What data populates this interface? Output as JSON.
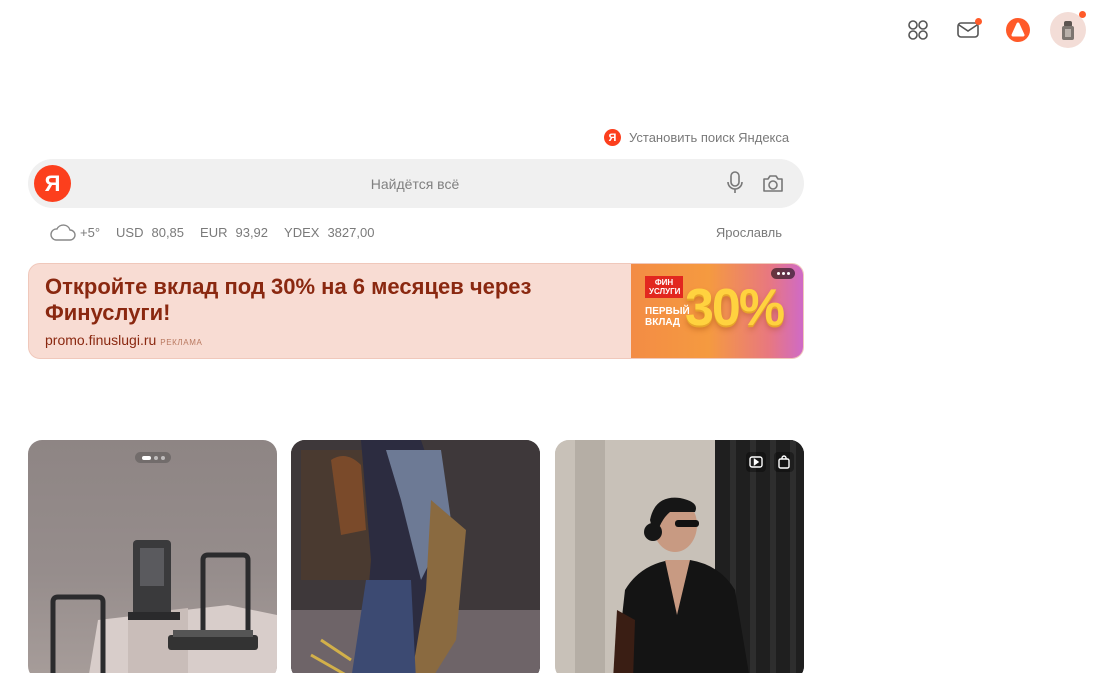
{
  "topbar": {
    "icons": [
      "services-grid-icon",
      "mail-icon",
      "alice-icon",
      "avatar"
    ]
  },
  "install": {
    "logo_letter": "Я",
    "text": "Установить поиск Яндекса"
  },
  "search": {
    "logo_letter": "Я",
    "placeholder": "Найдётся всё",
    "value": ""
  },
  "info": {
    "temperature": "+5°",
    "rates": [
      {
        "label": "USD",
        "value": "80,85"
      },
      {
        "label": "EUR",
        "value": "93,92"
      },
      {
        "label": "YDEX",
        "value": "3827,00"
      }
    ],
    "city": "Ярославль"
  },
  "banner": {
    "title": "Откройте вклад под 30% на 6 месяцев через Финуслуги!",
    "domain": "promo.finuslugi.ru",
    "tag": "РЕКЛАМА",
    "image": {
      "badge": "ФИН УСЛУГИ",
      "caption": "ПЕРВЫЙ ВКЛАД",
      "big_text": "30%"
    }
  },
  "feed": {
    "cards": [
      {
        "id": "card-1",
        "subject": "treadmills on podium"
      },
      {
        "id": "card-2",
        "subject": "fashion clothes rack"
      },
      {
        "id": "card-3",
        "subject": "woman in black suit"
      }
    ]
  },
  "colors": {
    "brand_red": "#fc3f1d",
    "notification_dot": "#ff5a29",
    "banner_bg": "#f8dcd3",
    "banner_text": "#8a2810"
  }
}
